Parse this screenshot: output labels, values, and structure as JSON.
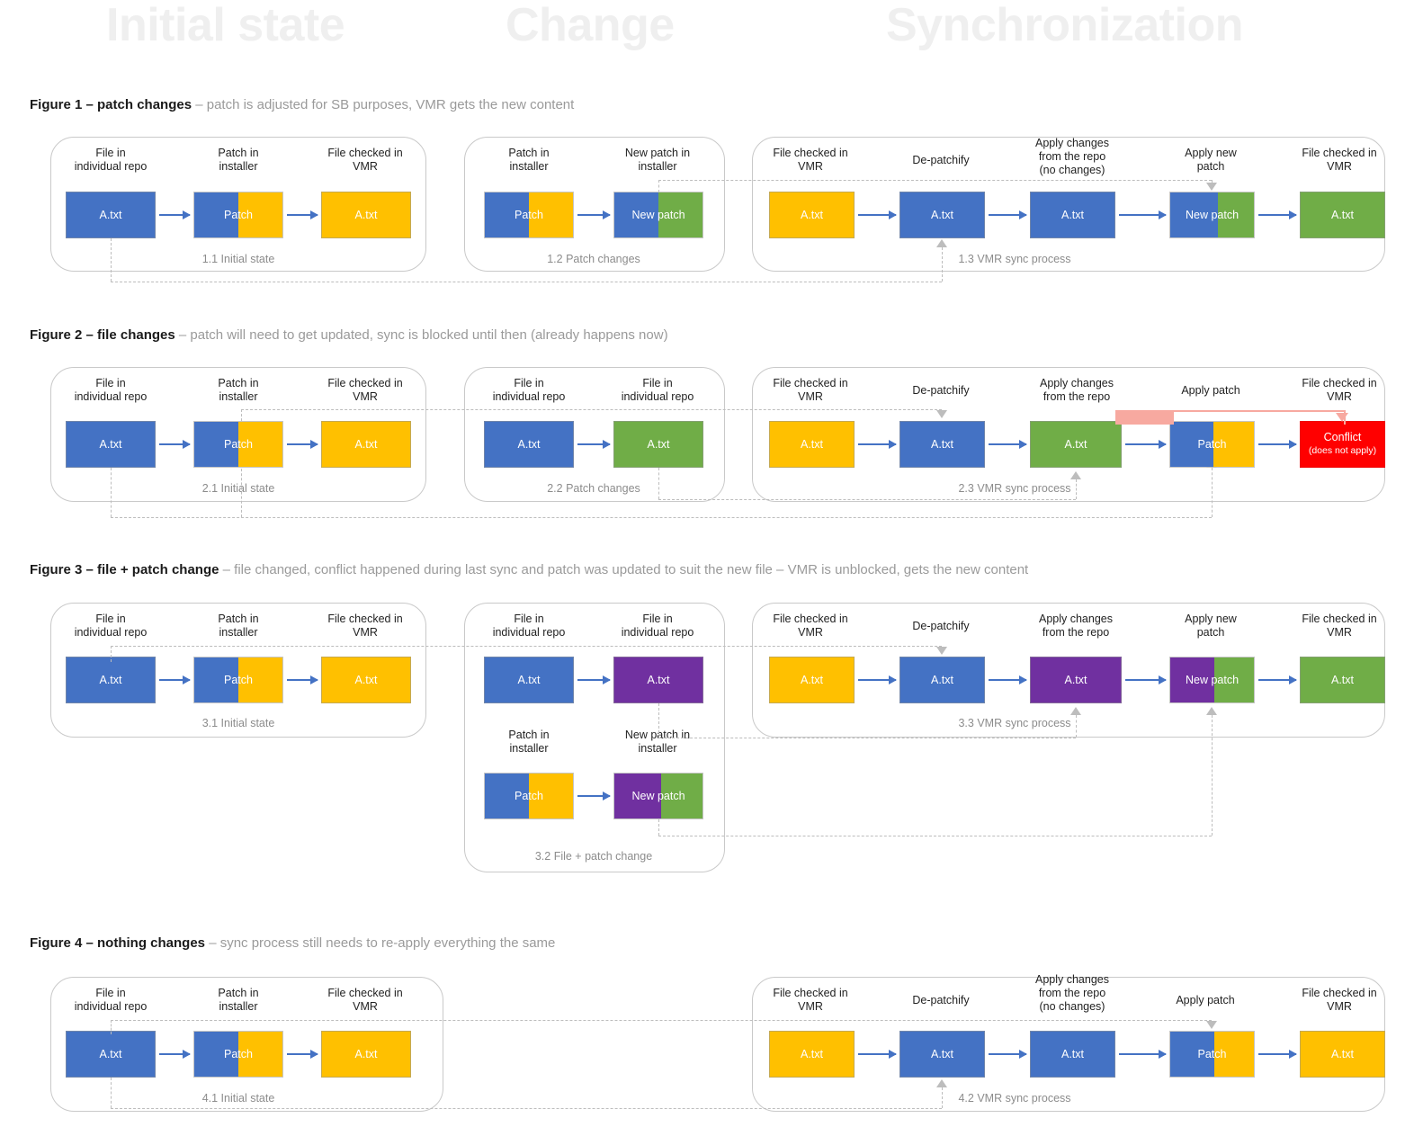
{
  "watermarks": {
    "initial": "Initial state",
    "change": "Change",
    "sync": "Synchronization"
  },
  "colors": {
    "blue": "#4472C4",
    "yellow": "#FFC000",
    "green": "#70AD47",
    "purple": "#7030A0",
    "red": "#FF0000",
    "salmon": "#F7A9A0",
    "group_border": "#C9C9C9",
    "dash": "#BDBDBD",
    "caption_grey": "#8C8C8C"
  },
  "figures": [
    {
      "id": "figure-1",
      "title_bold": "Figure 1 – patch changes",
      "title_rest": " – patch is adjusted for SB purposes, VMR gets the new content",
      "groups": [
        {
          "label": "1.1 Initial state",
          "nodes": [
            {
              "caption": "File in\nindividual repo",
              "text": "A.txt",
              "fill": "blue"
            },
            {
              "caption": "Patch in\ninstaller",
              "text": "Patch",
              "fill": "blue",
              "fill2": "yellow"
            },
            {
              "caption": "File checked in\nVMR",
              "text": "A.txt",
              "fill": "yellow"
            }
          ]
        },
        {
          "label": "1.2 Patch changes",
          "nodes": [
            {
              "caption": "Patch in\ninstaller",
              "text": "Patch",
              "fill": "blue",
              "fill2": "yellow"
            },
            {
              "caption": "New patch in\ninstaller",
              "text": "New patch",
              "fill": "blue",
              "fill2": "green"
            }
          ]
        },
        {
          "label": "1.3 VMR sync process",
          "nodes": [
            {
              "caption": "File checked in\nVMR",
              "text": "A.txt",
              "fill": "yellow"
            },
            {
              "caption": "De-patchify",
              "text": "A.txt",
              "fill": "blue"
            },
            {
              "caption": "Apply changes\nfrom the repo\n(no changes)",
              "text": "A.txt",
              "fill": "blue"
            },
            {
              "caption": "Apply new\npatch",
              "text": "New patch",
              "fill": "blue",
              "fill2": "green"
            },
            {
              "caption": "File checked in\nVMR",
              "text": "A.txt",
              "fill": "green"
            }
          ]
        }
      ]
    },
    {
      "id": "figure-2",
      "title_bold": "Figure 2 – file changes",
      "title_rest": " – patch will need to get updated, sync is blocked until then (already happens now)",
      "groups": [
        {
          "label": "2.1 Initial state",
          "nodes": [
            {
              "caption": "File in\nindividual repo",
              "text": "A.txt",
              "fill": "blue"
            },
            {
              "caption": "Patch in\ninstaller",
              "text": "Patch",
              "fill": "blue",
              "fill2": "yellow"
            },
            {
              "caption": "File checked in\nVMR",
              "text": "A.txt",
              "fill": "yellow"
            }
          ]
        },
        {
          "label": "2.2 Patch changes",
          "nodes": [
            {
              "caption": "File in\nindividual repo",
              "text": "A.txt",
              "fill": "blue"
            },
            {
              "caption": "File in\nindividual repo",
              "text": "A.txt",
              "fill": "green"
            }
          ]
        },
        {
          "label": "2.3 VMR sync process",
          "nodes": [
            {
              "caption": "File checked in\nVMR",
              "text": "A.txt",
              "fill": "yellow"
            },
            {
              "caption": "De-patchify",
              "text": "A.txt",
              "fill": "blue"
            },
            {
              "caption": "Apply changes\nfrom the repo",
              "text": "A.txt",
              "fill": "green"
            },
            {
              "caption": "Apply patch",
              "text": "Patch",
              "fill": "blue",
              "fill2": "yellow"
            },
            {
              "caption": "File checked in\nVMR",
              "text": "Conflict",
              "sub": "(does not apply)",
              "fill": "red"
            }
          ]
        }
      ]
    },
    {
      "id": "figure-3",
      "title_bold": "Figure 3 – file + patch change",
      "title_rest": " – file changed, conflict happened during last sync and patch was updated to suit the new file – VMR is unblocked, gets the new content",
      "groups": [
        {
          "label": "3.1 Initial state",
          "nodes": [
            {
              "caption": "File in\nindividual repo",
              "text": "A.txt",
              "fill": "blue"
            },
            {
              "caption": "Patch in\ninstaller",
              "text": "Patch",
              "fill": "blue",
              "fill2": "yellow"
            },
            {
              "caption": "File checked in\nVMR",
              "text": "A.txt",
              "fill": "yellow"
            }
          ]
        },
        {
          "label": "3.2 File + patch change",
          "nodes": [
            {
              "caption": "File in\nindividual repo",
              "text": "A.txt",
              "fill": "blue"
            },
            {
              "caption": "File in\nindividual repo",
              "text": "A.txt",
              "fill": "purple"
            },
            {
              "caption": "Patch in\ninstaller",
              "text": "Patch",
              "fill": "blue",
              "fill2": "yellow"
            },
            {
              "caption": "New patch in\ninstaller",
              "text": "New patch",
              "fill": "purple",
              "fill2": "green"
            }
          ]
        },
        {
          "label": "3.3 VMR sync process",
          "nodes": [
            {
              "caption": "File checked in\nVMR",
              "text": "A.txt",
              "fill": "yellow"
            },
            {
              "caption": "De-patchify",
              "text": "A.txt",
              "fill": "blue"
            },
            {
              "caption": "Apply changes\nfrom the repo",
              "text": "A.txt",
              "fill": "purple"
            },
            {
              "caption": "Apply new\npatch",
              "text": "New patch",
              "fill": "purple",
              "fill2": "green"
            },
            {
              "caption": "File checked in\nVMR",
              "text": "A.txt",
              "fill": "green"
            }
          ]
        }
      ]
    },
    {
      "id": "figure-4",
      "title_bold": "Figure 4 – nothing changes",
      "title_rest": " – sync process still needs to re-apply everything the same",
      "groups": [
        {
          "label": "4.1 Initial state",
          "nodes": [
            {
              "caption": "File in\nindividual repo",
              "text": "A.txt",
              "fill": "blue"
            },
            {
              "caption": "Patch in\ninstaller",
              "text": "Patch",
              "fill": "blue",
              "fill2": "yellow"
            },
            {
              "caption": "File checked in\nVMR",
              "text": "A.txt",
              "fill": "yellow"
            }
          ]
        },
        {
          "label": "4.2 VMR sync process",
          "nodes": [
            {
              "caption": "File checked in\nVMR",
              "text": "A.txt",
              "fill": "yellow"
            },
            {
              "caption": "De-patchify",
              "text": "A.txt",
              "fill": "blue"
            },
            {
              "caption": "Apply changes\nfrom the repo\n(no changes)",
              "text": "A.txt",
              "fill": "blue"
            },
            {
              "caption": "Apply patch",
              "text": "Patch",
              "fill": "blue",
              "fill2": "yellow"
            },
            {
              "caption": "File checked in\nVMR",
              "text": "A.txt",
              "fill": "yellow"
            }
          ]
        }
      ]
    }
  ]
}
